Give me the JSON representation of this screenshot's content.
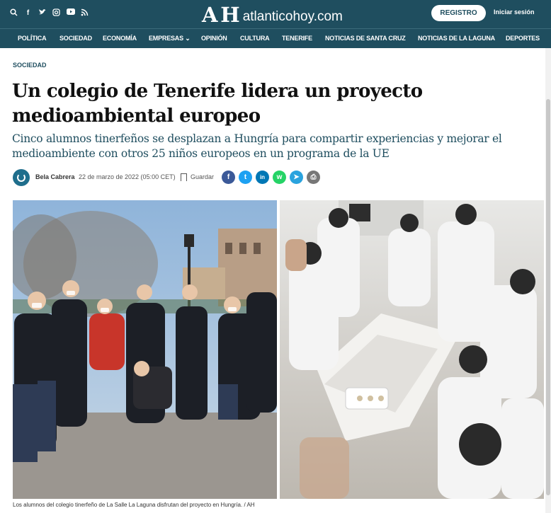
{
  "header": {
    "logo_mark": "A H",
    "logo_text": "atlanticohoy.com",
    "register_label": "REGISTRO",
    "login_label": "Iniciar sesión",
    "icons": [
      "search-icon",
      "facebook-icon",
      "twitter-icon",
      "instagram-icon",
      "youtube-icon",
      "rss-icon"
    ]
  },
  "nav": {
    "items": [
      "POLÍTICA",
      "SOCIEDAD",
      "ECONOMÍA",
      "EMPRESAS ⌄",
      "OPINIÓN",
      "CULTURA",
      "TENERIFE",
      "NOTICIAS DE SANTA CRUZ",
      "NOTICIAS DE LA LAGUNA",
      "DEPORTES"
    ]
  },
  "article": {
    "section": "SOCIEDAD",
    "title": "Un colegio de Tenerife lidera un proyecto medioambiental europeo",
    "subtitle": "Cinco alumnos tinerfeños se desplazan a Hungría para compartir experiencias y mejorar el medioambiente con otros 25 niños europeos en un programa de la UE",
    "author": "Bela Cabrera",
    "date": "22 de marzo de 2022 (05:00 CET)",
    "save_label": "Guardar",
    "share": [
      {
        "name": "facebook",
        "glyph": "f",
        "color": "#3b5998"
      },
      {
        "name": "twitter",
        "glyph": "t",
        "color": "#1da1f2"
      },
      {
        "name": "linkedin",
        "glyph": "in",
        "color": "#0077b5"
      },
      {
        "name": "whatsapp",
        "glyph": "w",
        "color": "#25d366"
      },
      {
        "name": "telegram",
        "glyph": "➤",
        "color": "#2aa3de"
      },
      {
        "name": "print",
        "glyph": "⎙",
        "color": "#777777"
      }
    ],
    "photo_caption": "Los alumnos del colegio tinerfeño de La Salle La Laguna disfrutan del proyecto en Hungría. / AH"
  }
}
